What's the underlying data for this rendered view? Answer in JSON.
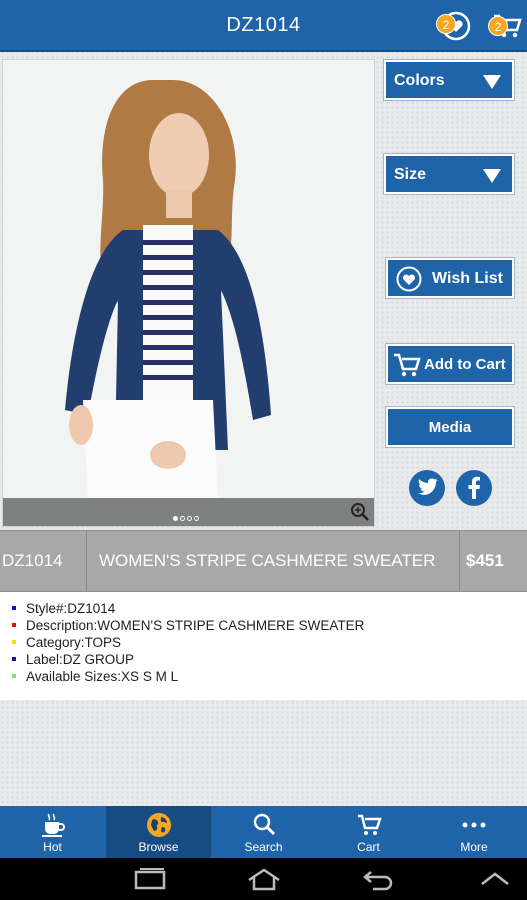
{
  "header": {
    "title": "DZ1014",
    "wishlist_count": "2",
    "cart_count": "2"
  },
  "side": {
    "colors_label": "Colors",
    "size_label": "Size",
    "wishlist_label": "Wish List",
    "add_cart_label": "Add to Cart",
    "media_label": "Media"
  },
  "product": {
    "code": "DZ1014",
    "name": "WOMEN'S STRIPE CASHMERE SWEATER",
    "price": "$451",
    "image_index": 1,
    "image_total": 4
  },
  "details": [
    {
      "text": "Style#:DZ1014",
      "bullet_color": "#1010cc"
    },
    {
      "text": "Description:WOMEN'S STRIPE CASHMERE SWEATER",
      "bullet_color": "#e01010"
    },
    {
      "text": "Category:TOPS",
      "bullet_color": "#e8e010"
    },
    {
      "text": "Label:DZ GROUP",
      "bullet_color": "#1010cc"
    },
    {
      "text": "Available Sizes:XS S M L",
      "bullet_color": "#80e080"
    }
  ],
  "tabs": [
    {
      "label": "Hot",
      "icon": "coffee-cup-icon"
    },
    {
      "label": "Browse",
      "icon": "globe-icon"
    },
    {
      "label": "Search",
      "icon": "search-icon"
    },
    {
      "label": "Cart",
      "icon": "cart-icon"
    },
    {
      "label": "More",
      "icon": "more-dots-icon"
    }
  ],
  "colors": {
    "primary": "#1f63a8",
    "badge": "#f6a623"
  }
}
